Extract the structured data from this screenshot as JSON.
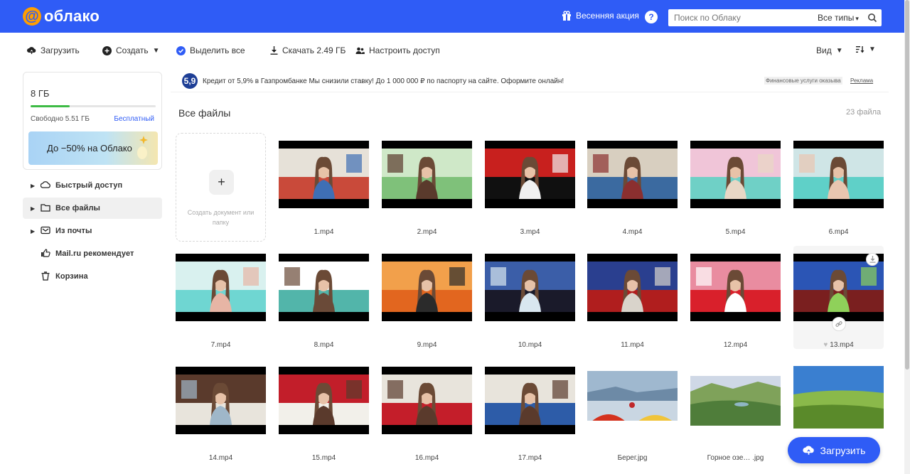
{
  "header": {
    "logo_text": "облако",
    "promo_label": "Весенняя акция",
    "help": "?",
    "search_placeholder": "Поиск по Облаку",
    "search_types": "Все типы"
  },
  "toolbar": {
    "upload": "Загрузить",
    "create": "Создать",
    "select_all": "Выделить все",
    "download": "Скачать 2.49 ГБ",
    "access": "Настроить доступ",
    "view": "Вид"
  },
  "storage": {
    "size": "8 ГБ",
    "free": "Свободно 5.51 ГБ",
    "free_link": "Бесплатный",
    "used_fraction": 0.31,
    "promo": "До −50% на Облако"
  },
  "nav": [
    {
      "label": "Быстрый доступ",
      "icon": "cloud-icon"
    },
    {
      "label": "Все файлы",
      "icon": "folder-icon"
    },
    {
      "label": "Из почты",
      "icon": "mail-icon"
    },
    {
      "label": "Mail.ru рекомендует",
      "icon": "thumb-up-icon"
    },
    {
      "label": "Корзина",
      "icon": "trash-icon"
    }
  ],
  "ad": {
    "logo": "5,9",
    "text": "Кредит от 5,9% в Газпромбанке  Мы снизили ставку! До 1 000 000 ₽ по паспорту на сайте. Оформите онлайн!",
    "disclaimer": "Финансовые услуги оказыва",
    "label": "Реклама"
  },
  "section": {
    "title": "Все файлы",
    "count": "23 файла"
  },
  "create_tile": {
    "plus": "+",
    "label": "Создать документ или папку"
  },
  "files": [
    {
      "name": "1.mp4",
      "type": "video",
      "palette": [
        "#c94a3a",
        "#e6e1d8",
        "#3f6fb5"
      ]
    },
    {
      "name": "2.mp4",
      "type": "video",
      "palette": [
        "#7fc17a",
        "#cfe8c8",
        "#5a3a2c"
      ]
    },
    {
      "name": "3.mp4",
      "type": "video",
      "palette": [
        "#101010",
        "#c8201e",
        "#f0f0f0"
      ]
    },
    {
      "name": "4.mp4",
      "type": "video",
      "palette": [
        "#3b6aa0",
        "#d8cfc0",
        "#8b2f2f"
      ]
    },
    {
      "name": "5.mp4",
      "type": "video",
      "palette": [
        "#6fd0c6",
        "#f0c5d8",
        "#e8d7c5"
      ]
    },
    {
      "name": "6.mp4",
      "type": "video",
      "palette": [
        "#5fd0c8",
        "#cfe5e6",
        "#e9c6b0"
      ]
    },
    {
      "name": "7.mp4",
      "type": "video",
      "palette": [
        "#6fd6d2",
        "#d9f1ef",
        "#e7b5a5"
      ]
    },
    {
      "name": "8.mp4",
      "type": "video",
      "palette": [
        "#52b5aa",
        "#ffffff",
        "#6a4a38"
      ]
    },
    {
      "name": "9.mp4",
      "type": "video",
      "palette": [
        "#e2661f",
        "#f2a04b",
        "#2b2b2b"
      ]
    },
    {
      "name": "10.mp4",
      "type": "video",
      "palette": [
        "#1a1a2a",
        "#3b5ea8",
        "#d9e7f0"
      ]
    },
    {
      "name": "11.mp4",
      "type": "video",
      "palette": [
        "#b01e1e",
        "#2a3f8f",
        "#d9d4cb"
      ]
    },
    {
      "name": "12.mp4",
      "type": "video",
      "palette": [
        "#d9202b",
        "#e98ca0",
        "#ffffff"
      ]
    },
    {
      "name": "13.mp4",
      "type": "video",
      "palette": [
        "#7a1f1f",
        "#2b55b5",
        "#8fd15a"
      ],
      "hover": true
    },
    {
      "name": "14.mp4",
      "type": "video",
      "palette": [
        "#e8e4dc",
        "#5a3a2c",
        "#9fb7c9"
      ]
    },
    {
      "name": "15.mp4",
      "type": "video",
      "palette": [
        "#f2f0ea",
        "#c21e2a",
        "#5a3a2c"
      ]
    },
    {
      "name": "16.mp4",
      "type": "video",
      "palette": [
        "#c41e2a",
        "#e8e4dc",
        "#5a3a2c"
      ]
    },
    {
      "name": "17.mp4",
      "type": "video",
      "palette": [
        "#2d5ca8",
        "#e8e4dc",
        "#5a3a2c"
      ]
    },
    {
      "name": "Берег.jpg",
      "type": "image",
      "palette": [
        "#9fb8cf",
        "#d4321e",
        "#f0c43a"
      ]
    },
    {
      "name": "Горное озе… .jpg",
      "type": "image",
      "palette": [
        "#cfd8e6",
        "#4f7d3a",
        "#7fa25a"
      ]
    },
    {
      "name": "",
      "type": "image",
      "palette": [
        "#3a7fd0",
        "#8ab94a",
        "#5a8a2a"
      ]
    }
  ],
  "fab": {
    "label": "Загрузить"
  }
}
